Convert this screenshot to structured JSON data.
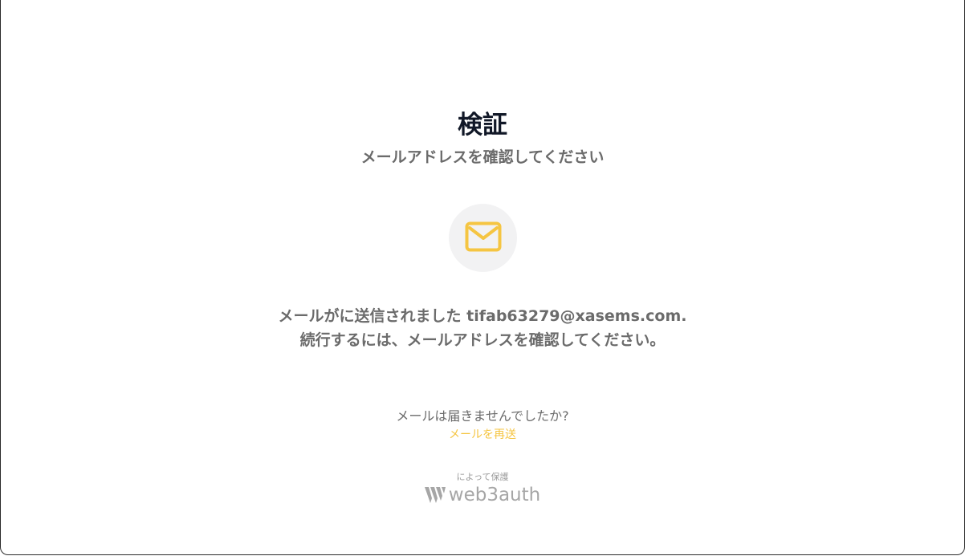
{
  "header": {
    "title": "検証",
    "subtitle": "メールアドレスを確認してください"
  },
  "icon": {
    "name": "envelope-icon",
    "color": "#f5c542",
    "background": "#f2f2f3"
  },
  "message": {
    "line1": "メールがに送信されました tifab63279@xasems.com.",
    "line2": "続行するには、メールアドレスを確認してください。"
  },
  "resend": {
    "question": "メールは届きませんでしたか?",
    "link_label": "メールを再送"
  },
  "footer": {
    "secured_by": "によって保護",
    "brand_name": "web3auth"
  },
  "colors": {
    "accent": "#f5c542",
    "title": "#111827",
    "body_text": "#6b6b6b",
    "muted": "#a6a6a6"
  }
}
